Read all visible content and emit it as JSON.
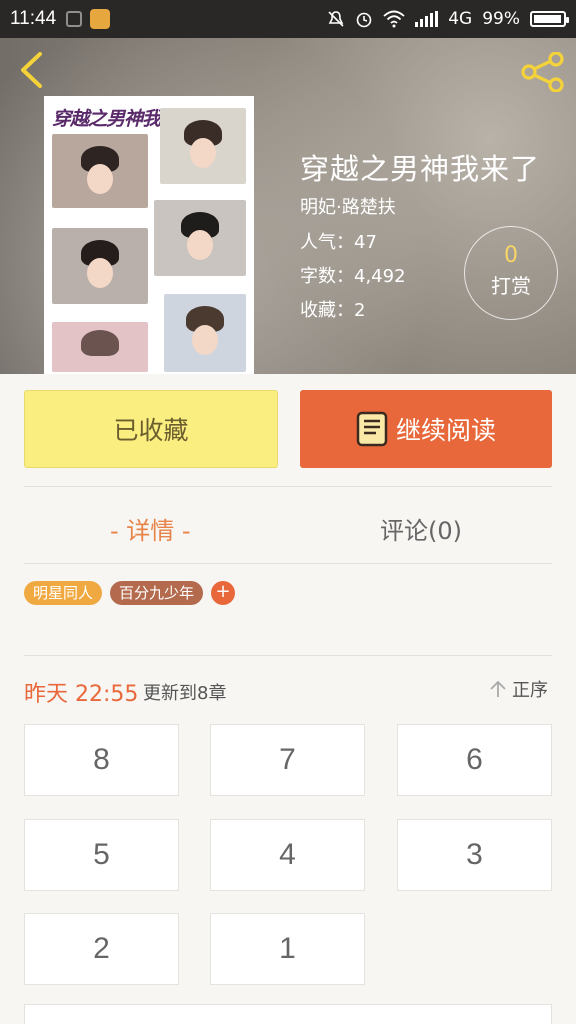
{
  "status": {
    "time": "11:44",
    "network": "4G",
    "battery": "99%"
  },
  "book": {
    "title": "穿越之男神我来了",
    "cover_title": "穿越之男神我来了",
    "author": "明妃·路楚扶",
    "popularity_label": "人气：47",
    "words_label": "字数：4,492",
    "favorites_label": "收藏：2"
  },
  "reward": {
    "count": "0",
    "label": "打赏"
  },
  "actions": {
    "favorited_label": "已收藏",
    "continue_label": "继续阅读"
  },
  "tabs": [
    {
      "label": "- 详情 -"
    },
    {
      "label": "评论(0)"
    }
  ],
  "tags": [
    {
      "label": "明星同人"
    },
    {
      "label": "百分九少年"
    },
    {
      "label": "+"
    }
  ],
  "update": {
    "time": "昨天 22:55",
    "text": "更新到8章",
    "sort_label": "正序"
  },
  "chapters": [
    "8",
    "7",
    "6",
    "5",
    "4",
    "3",
    "2",
    "1"
  ],
  "colors": {
    "accent": "#e8683b",
    "fav_button": "#fbee80",
    "tag_orange": "#f0a940",
    "tag_brown": "#b46a4d",
    "reward_number": "#f7d565"
  },
  "icons": {
    "back": "chevron-left-icon",
    "share": "share-icon",
    "continue": "book-icon",
    "sort": "arrow-up-icon"
  }
}
